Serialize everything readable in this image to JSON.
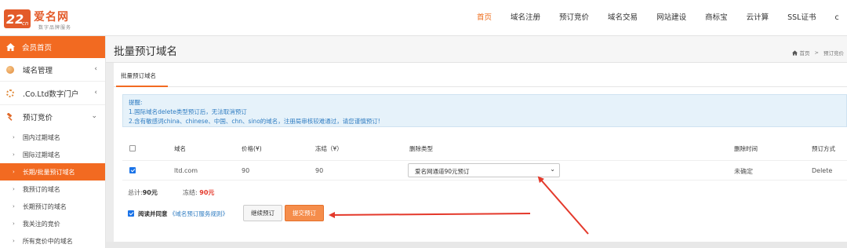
{
  "brand": {
    "name": "爱名网",
    "slogan": "数字品牌服务",
    "badge": "22cn",
    "color": "#e35b2a"
  },
  "nav": [
    {
      "label": "首页",
      "active": true
    },
    {
      "label": "域名注册"
    },
    {
      "label": "预订竞价"
    },
    {
      "label": "域名交易"
    },
    {
      "label": "网站建设"
    },
    {
      "label": "商标宝"
    },
    {
      "label": "云计算"
    },
    {
      "label": "SSL证书"
    },
    {
      "label": "c"
    }
  ],
  "sidebar": {
    "home": "会员首页",
    "items": [
      {
        "label": "域名管理",
        "icon": "globe-icon"
      },
      {
        "label": ".Co.Ltd数字门户",
        "icon": "gear-icon"
      },
      {
        "label": "预订竞价",
        "icon": "hammer-icon"
      }
    ],
    "sub": [
      {
        "label": "国内过期域名"
      },
      {
        "label": "国际过期域名"
      },
      {
        "label": "长期/批量预订域名",
        "active": true
      },
      {
        "label": "我预订的域名"
      },
      {
        "label": "长期预订的域名"
      },
      {
        "label": "我关注的竞价"
      },
      {
        "label": "所有竞价中的域名"
      }
    ]
  },
  "page": {
    "title": "批量预订域名",
    "breadcrumb": [
      "首页",
      "预订竞价"
    ],
    "tab": "批量预订域名"
  },
  "notice": {
    "title": "提醒:",
    "line1": "1.国际域名delete类型预订后，无法取消预订",
    "line2": "2.含有敏感词china、chinese、中国、chn、sino的域名，注册局审核较难通过，请您谨慎预订!"
  },
  "table": {
    "headers": [
      "域名",
      "价格(¥)",
      "冻结（¥）",
      "删除类型",
      "删除时间",
      "预订方式"
    ],
    "rows": [
      {
        "domain": "ltd.com",
        "price": "90",
        "freeze": "90",
        "delete_type": "爱名网通道90元预订",
        "delete_time": "未确定",
        "method": "Delete"
      }
    ]
  },
  "summary": {
    "total_label": "总计:",
    "total_value": "90元",
    "freeze_label": "冻结:",
    "freeze_value": "90元"
  },
  "agree": {
    "prefix": "阅读并同意",
    "link": "《域名预订服务规则》"
  },
  "buttons": {
    "continue": "继续预订",
    "submit": "提交预订"
  },
  "colors": {
    "accent": "#f26a21",
    "notice_text": "#2f7cc1",
    "annotation": "#e4392b"
  }
}
